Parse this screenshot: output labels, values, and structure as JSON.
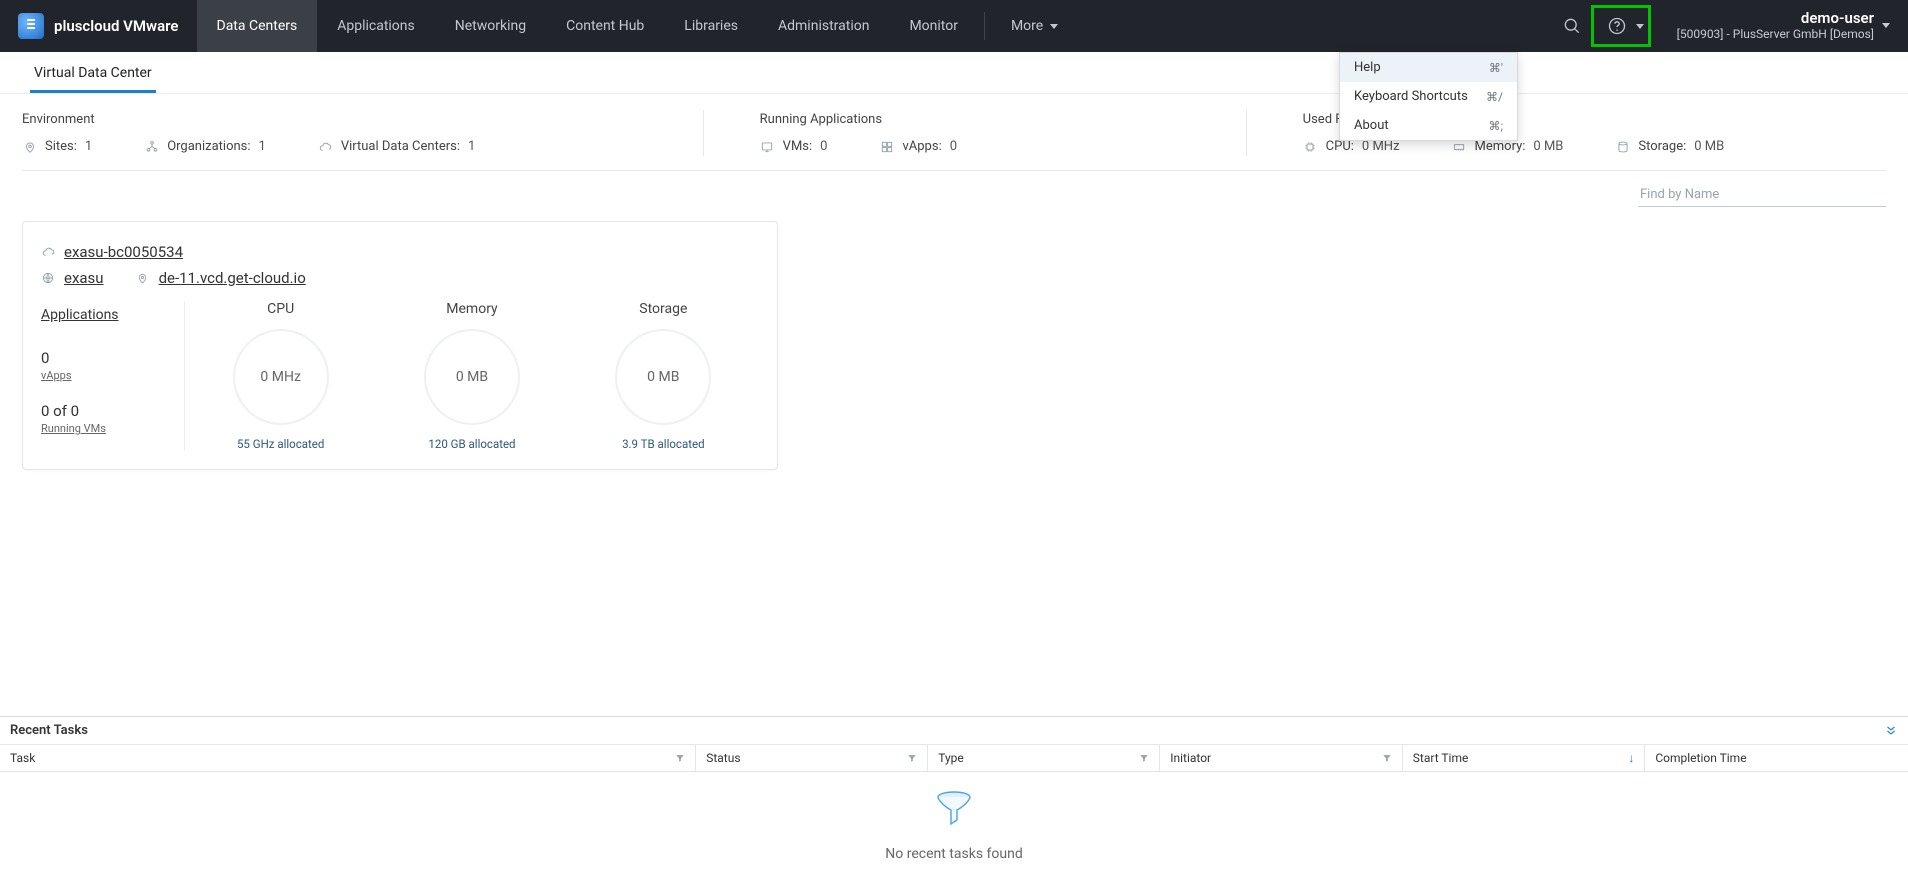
{
  "brand": {
    "title": "pluscloud VMware"
  },
  "nav": {
    "items": [
      {
        "label": "Data Centers",
        "active": true,
        "name": "nav-data-centers"
      },
      {
        "label": "Applications",
        "active": false,
        "name": "nav-applications"
      },
      {
        "label": "Networking",
        "active": false,
        "name": "nav-networking"
      },
      {
        "label": "Content Hub",
        "active": false,
        "name": "nav-content-hub"
      },
      {
        "label": "Libraries",
        "active": false,
        "name": "nav-libraries"
      },
      {
        "label": "Administration",
        "active": false,
        "name": "nav-administration"
      },
      {
        "label": "Monitor",
        "active": false,
        "name": "nav-monitor"
      }
    ],
    "more_label": "More"
  },
  "user": {
    "name": "demo-user",
    "org": "[500903] - PlusServer GmbH [Demos]"
  },
  "help_menu": [
    {
      "label": "Help",
      "shortcut": "⌘'",
      "hover": true,
      "name": "menu-help"
    },
    {
      "label": "Keyboard Shortcuts",
      "shortcut": "⌘/",
      "hover": false,
      "name": "menu-keyboard-shortcuts"
    },
    {
      "label": "About",
      "shortcut": "⌘;",
      "hover": false,
      "name": "menu-about"
    }
  ],
  "subtabs": [
    {
      "label": "Virtual Data Center",
      "active": true,
      "name": "subtab-vdc"
    }
  ],
  "summary": {
    "env_title": "Environment",
    "sites_label": "Sites:",
    "sites_value": "1",
    "orgs_label": "Organizations:",
    "orgs_value": "1",
    "vdc_label": "Virtual Data Centers:",
    "vdc_value": "1",
    "apps_title": "Running Applications",
    "vms_label": "VMs:",
    "vms_value": "0",
    "vapps_label": "vApps:",
    "vapps_value": "0",
    "res_title": "Used Resources",
    "cpu_label": "CPU:",
    "cpu_value": "0 MHz",
    "mem_label": "Memory:",
    "mem_value": "0 MB",
    "sto_label": "Storage:",
    "sto_value": "0 MB"
  },
  "search": {
    "placeholder": "Find by Name"
  },
  "card": {
    "name": "exasu-bc0050534",
    "org": "exasu",
    "site": "de-11.vcd.get-cloud.io",
    "apps_title": "Applications",
    "vapps_count": "0",
    "vapps_sub": "vApps",
    "vms_count": "0 of 0",
    "vms_sub": "Running VMs",
    "gauges": [
      {
        "title": "CPU",
        "value": "0 MHz",
        "alloc": "55 GHz allocated"
      },
      {
        "title": "Memory",
        "value": "0 MB",
        "alloc": "120 GB allocated"
      },
      {
        "title": "Storage",
        "value": "0 MB",
        "alloc": "3.9 TB allocated"
      }
    ]
  },
  "tasks": {
    "title": "Recent Tasks",
    "headers": [
      "Task",
      "Status",
      "Type",
      "Initiator",
      "Start Time",
      "Completion Time"
    ],
    "empty": "No recent tasks found"
  }
}
